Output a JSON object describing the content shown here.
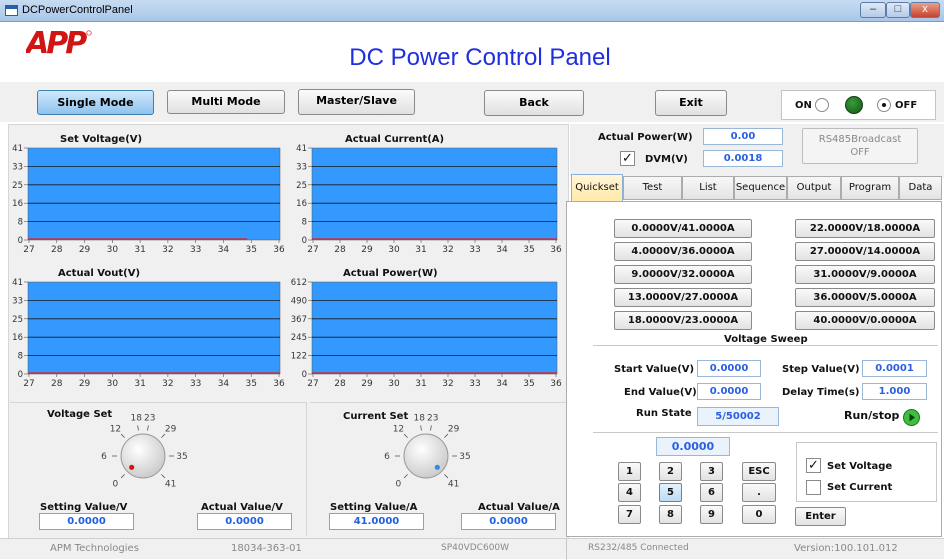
{
  "window": {
    "title": "DCPowerControlPanel",
    "min_glyph": "–",
    "max_glyph": "□",
    "close_glyph": "x"
  },
  "header": {
    "logo_text": "APP",
    "title": "DC Power Control Panel"
  },
  "toolbar": {
    "single_mode": "Single Mode",
    "multi_mode": "Multi Mode",
    "master_slave": "Master/Slave",
    "back": "Back",
    "exit": "Exit",
    "on_label": "ON",
    "off_label": "OFF",
    "selected_mode": "Single Mode"
  },
  "charts": [
    {
      "title": "Set Voltage(V)",
      "yticks": [
        "41",
        "33",
        "25",
        "16",
        "8",
        "0"
      ],
      "xticks": [
        "27",
        "28",
        "29",
        "30",
        "31",
        "32",
        "33",
        "34",
        "35",
        "36"
      ]
    },
    {
      "title": "Actual Current(A)",
      "yticks": [
        "41",
        "33",
        "25",
        "16",
        "8",
        "0"
      ],
      "xticks": [
        "27",
        "28",
        "29",
        "30",
        "31",
        "32",
        "33",
        "34",
        "35",
        "36"
      ]
    },
    {
      "title": "Actual Vout(V)",
      "yticks": [
        "41",
        "33",
        "25",
        "16",
        "8",
        "0"
      ],
      "xticks": [
        "27",
        "28",
        "29",
        "30",
        "31",
        "32",
        "33",
        "34",
        "35",
        "36"
      ]
    },
    {
      "title": "Actual Power(W)",
      "yticks": [
        "612",
        "490",
        "367",
        "245",
        "122",
        "0"
      ],
      "xticks": [
        "27",
        "28",
        "29",
        "30",
        "31",
        "32",
        "33",
        "34",
        "35",
        "36"
      ]
    }
  ],
  "chart_colors": {
    "plot_bg": "#3399ff",
    "grid": "#1a1a1a",
    "trace": "#e02020"
  },
  "voltage_set": {
    "title": "Voltage Set",
    "dial_labels": [
      "0",
      "6",
      "12",
      "18",
      "23",
      "29",
      "35",
      "41"
    ],
    "setting_label": "Setting Value/V",
    "actual_label": "Actual Value/V",
    "setting_value": "0.0000",
    "actual_value": "0.0000"
  },
  "current_set": {
    "title": "Current Set",
    "dial_labels": [
      "0",
      "6",
      "12",
      "18",
      "23",
      "29",
      "35",
      "41"
    ],
    "setting_label": "Setting Value/A",
    "actual_label": "Actual Value/A",
    "setting_value": "41.0000",
    "actual_value": "0.0000"
  },
  "right_top": {
    "actual_power_label": "Actual Power(W)",
    "actual_power_value": "0.00",
    "dvm_label": "DVM(V)",
    "dvm_value": "0.0018",
    "dvm_checked": "✓",
    "rs485_label": "RS485Broadcast",
    "rs485_state": "OFF"
  },
  "tabs": [
    "Quickset",
    "Test",
    "List",
    "Sequence",
    "Output",
    "Program",
    "Data"
  ],
  "quickset": {
    "left": [
      "0.0000V/41.0000A",
      "4.0000V/36.0000A",
      "9.0000V/32.0000A",
      "13.0000V/27.0000A",
      "18.0000V/23.0000A"
    ],
    "right": [
      "22.0000V/18.0000A",
      "27.0000V/14.0000A",
      "31.0000V/9.0000A",
      "36.0000V/5.0000A",
      "40.0000V/0.0000A"
    ]
  },
  "sweep": {
    "title": "Voltage Sweep",
    "start_label": "Start Value(V)",
    "start_value": "0.0000",
    "step_label": "Step Value(V)",
    "step_value": "0.0001",
    "end_label": "End Value(V)",
    "end_value": "0.0000",
    "delay_label": "Delay Time(s)",
    "delay_value": "1.000",
    "run_state_label": "Run State",
    "run_state_value": "5/50002",
    "run_stop_label": "Run/stop"
  },
  "keypad": {
    "display": "0.0000",
    "keys": [
      "1",
      "2",
      "3",
      "ESC",
      "4",
      "5",
      "6",
      ".",
      "7",
      "8",
      "9",
      "0"
    ],
    "enter": "Enter",
    "set_voltage": "Set Voltage",
    "set_current": "Set Current",
    "set_voltage_checked": "✓"
  },
  "status": {
    "company": "APM Technologies",
    "serial": "18034-363-01",
    "model": "SP40VDC600W",
    "connection": "RS232/485 Connected",
    "version": "Version:100.101.012"
  }
}
